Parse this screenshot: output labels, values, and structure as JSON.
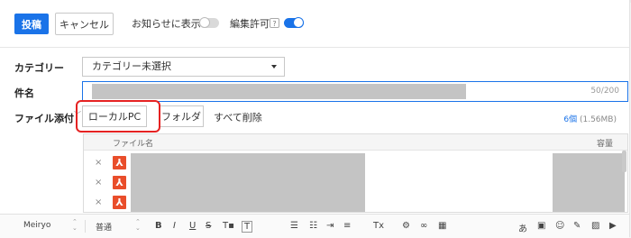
{
  "toolbar": {
    "post_label": "投稿",
    "cancel_label": "キャンセル",
    "notice_label": "お知らせに表示",
    "notice_on": false,
    "edit_label": "編集許可",
    "help": "?",
    "edit_on": true
  },
  "form": {
    "category_label": "カテゴリー",
    "category_value": "カテゴリー未選択",
    "title_label": "件名",
    "title_counter": "50/200",
    "attach_label": "ファイル添付",
    "local_pc": "ローカルPC",
    "folder": "フォルダ",
    "delete_all": "すべて削除",
    "file_count": "6個",
    "file_size": "(1.56MB)"
  },
  "file_table": {
    "col_name": "ファイル名",
    "col_size": "容量",
    "rows": [
      {
        "remove": "×",
        "icon": "pdf-icon"
      },
      {
        "remove": "×",
        "icon": "pdf-icon"
      },
      {
        "remove": "×",
        "icon": "pdf-icon"
      }
    ]
  },
  "editor": {
    "font": "Meiryo",
    "size": "普通",
    "bold": "B",
    "italic": "I",
    "underline": "U",
    "strike": "S",
    "clear": "Tx"
  },
  "colors": {
    "accent": "#1a73e8",
    "highlight": "#e52222",
    "pdf": "#e94e2b"
  }
}
